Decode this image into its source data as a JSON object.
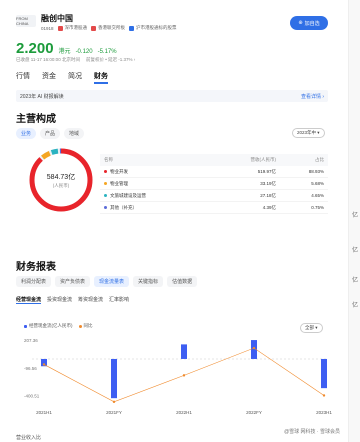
{
  "header": {
    "logo_text": "FROM CHINA",
    "company": "融创中国",
    "code": "01918",
    "tags": [
      "深市港股通",
      "香港联交所板",
      "沪市港股通标的股票"
    ],
    "tag_colors": [
      "#e34a4a",
      "#e34a4a",
      "#2f6fe6"
    ],
    "follow_label": "加自选"
  },
  "quote": {
    "price": "2.200",
    "unit": "港元",
    "change": "-0.120",
    "pct": "-5.17%",
    "info_left": "已收盘 11-17 16:00:00 北京时间",
    "info_right": "前复权价 • 延迟 -1.37% ›"
  },
  "main_tabs": [
    "行情",
    "资金",
    "简况",
    "财务"
  ],
  "ai": {
    "text": "2023年 AI 财报解读",
    "link": "查看详情 ›"
  },
  "biz": {
    "title": "主营构成",
    "filters": [
      "业务",
      "产品",
      "地域"
    ],
    "year": "2023年中 ▾",
    "donut_value": "584.73亿",
    "donut_unit": "(人民币)",
    "headers": [
      "名称",
      "营收(人民币)",
      "占比"
    ],
    "rows": [
      {
        "name": "物业开发",
        "value": "519.97亿",
        "pct": "88.93%",
        "color": "#e8242b"
      },
      {
        "name": "物业管理",
        "value": "33.19亿",
        "pct": "5.68%",
        "color": "#f5a623"
      },
      {
        "name": "文旅城建设及运营",
        "value": "27.18亿",
        "pct": "4.65%",
        "color": "#2bb3c0"
      },
      {
        "name": "其他（补充）",
        "value": "4.39亿",
        "pct": "0.75%",
        "color": "#5b6bd8"
      }
    ]
  },
  "finance": {
    "title": "财务报表",
    "subtabs": [
      "利润分配表",
      "资产负债表",
      "现金流量表",
      "关键指标",
      "估值数据"
    ],
    "flow_tabs": [
      "经营现金流",
      "投资现金流",
      "筹资现金流",
      "汇率影响"
    ],
    "legend_bar": "经营现金流(亿人民币)",
    "legend_line": "同比",
    "period_select": "全部 ▾"
  },
  "chart_data": {
    "type": "bar",
    "categories": [
      "2021H1",
      "",
      "2021FY",
      "",
      "2022H1",
      "",
      "2022FY",
      "",
      "2023H1"
    ],
    "series": [
      {
        "name": "经营现金流(亿人民币)",
        "values": [
          -80,
          null,
          -430,
          null,
          160,
          null,
          207.36,
          null,
          -320
        ]
      },
      {
        "name": "同比",
        "values": [
          -60,
          null,
          -470,
          null,
          -180,
          null,
          120,
          null,
          -400
        ]
      }
    ],
    "yticks": [
      "207.36",
      "-96.56",
      "-400.51"
    ],
    "ylim": [
      -450,
      230
    ]
  },
  "footer": {
    "text": "营业收入比",
    "watermark": "@雪球 网科技 · 雪球会员"
  }
}
